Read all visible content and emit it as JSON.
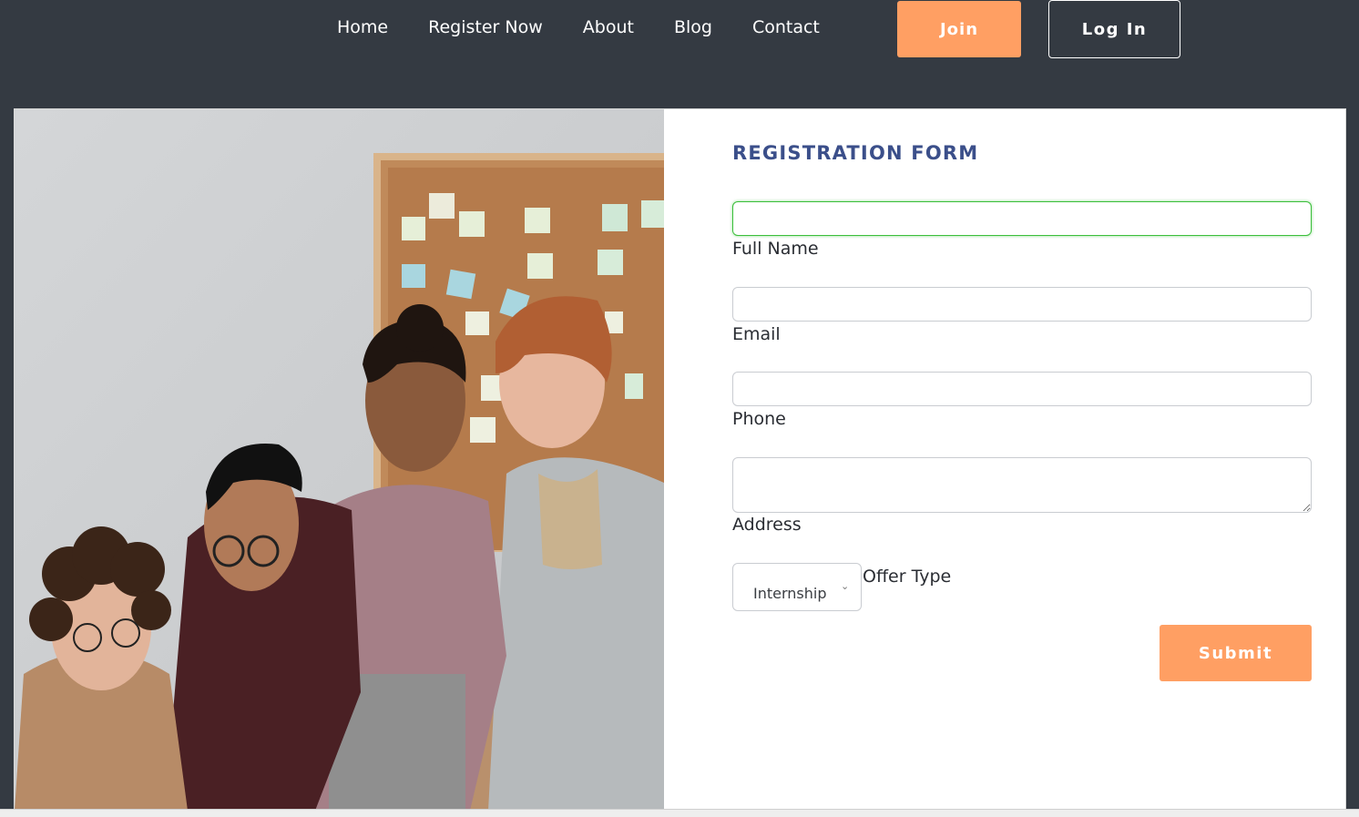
{
  "nav": {
    "links": [
      "Home",
      "Register Now",
      "About",
      "Blog",
      "Contact"
    ],
    "join_label": "Join",
    "login_label": "Log In"
  },
  "form": {
    "title": "REGISTRATION FORM",
    "fields": {
      "full_name": {
        "label": "Full Name",
        "value": ""
      },
      "email": {
        "label": "Email",
        "value": ""
      },
      "phone": {
        "label": "Phone",
        "value": ""
      },
      "address": {
        "label": "Address",
        "value": ""
      }
    },
    "offer_type": {
      "label": "Offer Type",
      "selected": "Internship"
    },
    "submit_label": "Submit"
  },
  "colors": {
    "background": "#343a42",
    "accent": "#ff9f63",
    "title": "#3b4f8a",
    "focus_border": "#3bbf3b"
  }
}
